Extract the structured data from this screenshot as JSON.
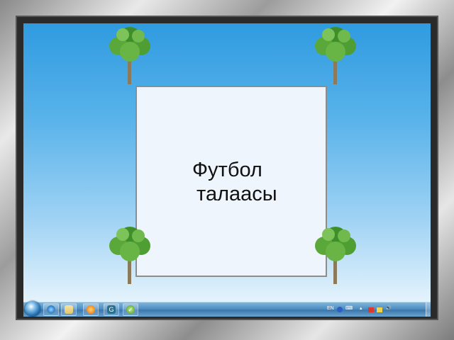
{
  "card": {
    "line1": "Футбол",
    "line2": "талаасы"
  },
  "trees": [
    "tree-icon",
    "tree-icon",
    "tree-icon",
    "tree-icon"
  ],
  "taskbar": {
    "start": "windows-start-orb-icon",
    "pinned": [
      {
        "name": "internet-explorer-icon",
        "color": "#2c7fd0"
      },
      {
        "name": "file-explorer-icon",
        "color": "#e6c36a"
      },
      {
        "name": "media-player-icon",
        "color": "#f08a1c"
      },
      {
        "name": "app-g-icon",
        "color": "#2b6f8f"
      },
      {
        "name": "app-check-icon",
        "color": "#6bb33a"
      }
    ],
    "tray": {
      "language": "EN",
      "icons": [
        "help-icon",
        "keyboard-icon",
        "chevron-up-icon",
        "flag-icon",
        "network-icon",
        "volume-icon"
      ]
    }
  },
  "colors": {
    "sky_top": "#2f9be0",
    "sky_bottom": "#e4f3fc",
    "card_bg": "#eef5fc"
  }
}
